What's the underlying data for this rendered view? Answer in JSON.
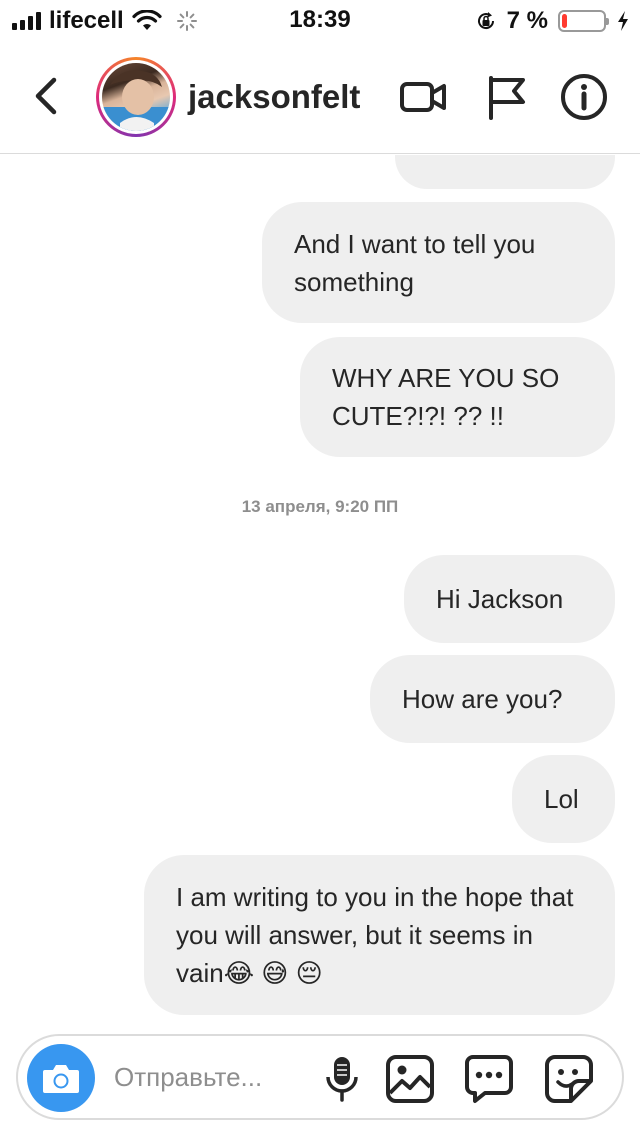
{
  "status_bar": {
    "carrier": "lifecell",
    "time": "18:39",
    "battery_percent_label": "7 %",
    "battery_level": 0.07,
    "battery_color": "#ff3b30"
  },
  "header": {
    "username": "jacksonfelt",
    "icons": [
      "back-chevron-icon",
      "video-camera-icon",
      "flag-icon",
      "info-icon"
    ]
  },
  "messages": [
    {
      "text": "",
      "partial": true
    },
    {
      "text": "And I want to tell you something"
    },
    {
      "text": "WHY ARE YOU SO CUTE?!?! ?? !!"
    },
    {
      "text": "Hi Jackson"
    },
    {
      "text": "How are you?"
    },
    {
      "text": "Lol"
    },
    {
      "text": "I am writing to you in the hope that you will answer, but it seems in vain😂 😅 😔"
    }
  ],
  "timestamp": "13 апреля, 9:20 ПП",
  "composer": {
    "placeholder": "Отправьте...",
    "icons": [
      "camera-icon",
      "microphone-icon",
      "gallery-icon",
      "chat-bubble-icon",
      "sticker-icon"
    ],
    "accent": "#3897f0"
  },
  "colors": {
    "bubble": "#efefef",
    "text": "#262626",
    "muted": "#8e8e8e"
  }
}
